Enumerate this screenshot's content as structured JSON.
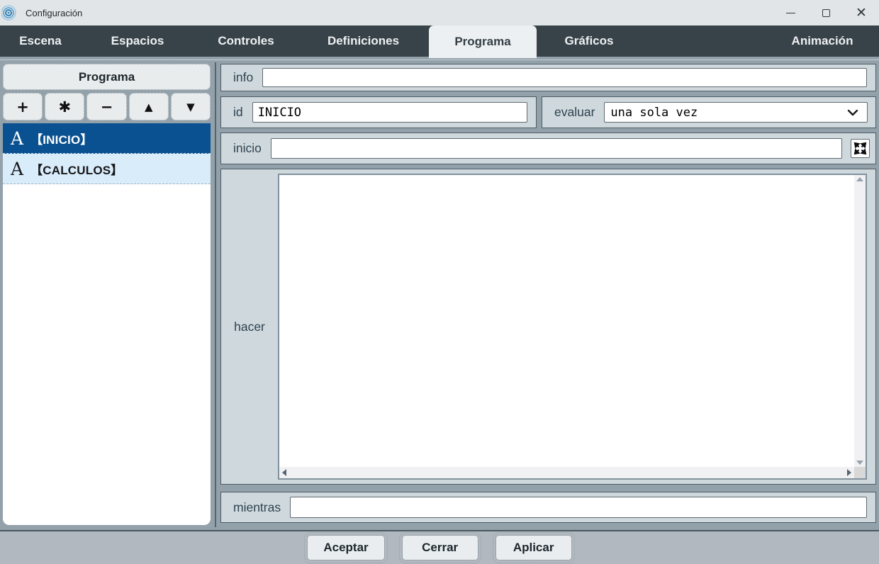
{
  "window": {
    "title": "Configuración"
  },
  "tabs": [
    {
      "label": "Escena"
    },
    {
      "label": "Espacios"
    },
    {
      "label": "Controles"
    },
    {
      "label": "Definiciones"
    },
    {
      "label": "Programa",
      "active": true
    },
    {
      "label": "Gráficos"
    },
    {
      "label": "Animación"
    }
  ],
  "left_panel": {
    "header": "Programa",
    "toolbar": {
      "add": "+",
      "asterisk": "✱",
      "remove": "−",
      "up": "▲",
      "down": "▼"
    },
    "items": [
      {
        "glyph": "A",
        "label": "【INICIO】",
        "selected": true
      },
      {
        "glyph": "A",
        "label": "【CALCULOS】",
        "selected": false
      }
    ]
  },
  "form": {
    "info_label": "info",
    "info_value": "",
    "id_label": "id",
    "id_value": "INICIO",
    "evaluar_label": "evaluar",
    "evaluar_value": "una sola vez",
    "inicio_label": "inicio",
    "inicio_value": "",
    "hacer_label": "hacer",
    "hacer_value": "",
    "mientras_label": "mientras",
    "mientras_value": ""
  },
  "footer": {
    "accept": "Aceptar",
    "close": "Cerrar",
    "apply": "Aplicar"
  },
  "colors": {
    "tabbar": "#384349",
    "selected_item": "#0a5191",
    "row_bg": "#cfd8dc",
    "content_bg": "#93a1aa"
  }
}
